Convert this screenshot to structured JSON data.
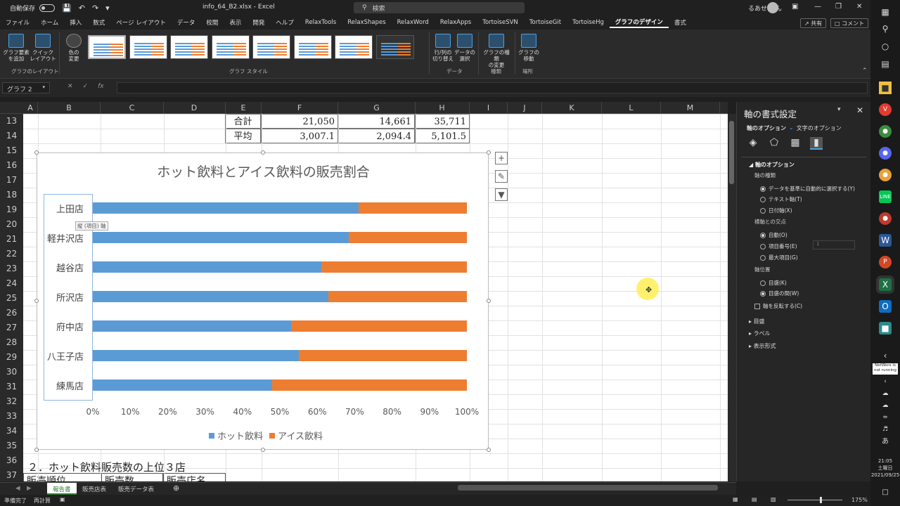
{
  "titlebar": {
    "autosave": "自動保存",
    "filename": "info_64_B2.xlsx  -  Excel",
    "search": "検索",
    "user": "るあせ くん"
  },
  "menu": [
    "ファイル",
    "ホーム",
    "挿入",
    "数式",
    "ページ レイアウト",
    "データ",
    "校閲",
    "表示",
    "開発",
    "ヘルプ",
    "RelaxTools",
    "RelaxShapes",
    "RelaxWord",
    "RelaxApps",
    "TortoiseSVN",
    "TortoiseGit",
    "TortoiseHg",
    "グラフのデザイン",
    "書式"
  ],
  "share": "共有",
  "comment": "コメント",
  "ribbon": {
    "add_element": "グラフ要素\nを追加",
    "quick_layout": "クイック\nレイアウト",
    "change_color": "色の\n変更",
    "switch_rowcol": "行/列の\n切り替え",
    "select_data": "データの\n選択",
    "change_type": "グラフの種類\nの変更",
    "move_chart": "グラフの\n移動",
    "groups": {
      "layout": "グラフのレイアウト",
      "styles": "グラフ スタイル",
      "data": "データ",
      "type": "種類",
      "location": "場所"
    }
  },
  "namebox": "グラフ 2",
  "columns": [
    "A",
    "B",
    "C",
    "D",
    "E",
    "F",
    "G",
    "H",
    "I",
    "J",
    "K",
    "L",
    "M"
  ],
  "rows": [
    "13",
    "14",
    "15",
    "16",
    "17",
    "18",
    "19",
    "20",
    "21",
    "22",
    "23",
    "24",
    "25",
    "26",
    "27",
    "28",
    "29",
    "30",
    "31",
    "32",
    "33",
    "34",
    "35",
    "36",
    "37"
  ],
  "table": {
    "sum_label": "合計",
    "avg_label": "平均",
    "sum": [
      "21,050",
      "14,661",
      "35,711"
    ],
    "avg": [
      "3,007.1",
      "2,094.4",
      "5,101.5"
    ]
  },
  "heading36": "２．ホット飲料販売数の上位３店",
  "row37": [
    "販売順位",
    "販売数",
    "販売店名"
  ],
  "axis_tooltip": "縦 (項目) 軸",
  "chart_data": {
    "type": "bar",
    "title": "ホット飲料とアイス飲料の販売割合",
    "categories": [
      "上田店",
      "軽井沢店",
      "越谷店",
      "所沢店",
      "府中店",
      "八王子店",
      "練馬店"
    ],
    "series": [
      {
        "name": "ホット飲料",
        "values": [
          0.71,
          0.685,
          0.61,
          0.63,
          0.53,
          0.55,
          0.48
        ],
        "color": "#5b9bd5"
      },
      {
        "name": "アイス飲料",
        "values": [
          0.29,
          0.315,
          0.39,
          0.37,
          0.47,
          0.45,
          0.52
        ],
        "color": "#ed7d31"
      }
    ],
    "xticks": [
      "0%",
      "10%",
      "20%",
      "30%",
      "40%",
      "50%",
      "60%",
      "70%",
      "80%",
      "90%",
      "100%"
    ],
    "xlim": [
      0,
      1
    ],
    "stacked": "100%",
    "legend": "bottom"
  },
  "sheets": [
    "報告書",
    "販売店表",
    "販売データ表"
  ],
  "status": {
    "ready": "準備完了",
    "recalc": "再計算",
    "zoom": "175%"
  },
  "pane": {
    "title": "軸の書式設定",
    "tab_axis": "軸のオプション",
    "tab_text": "文字のオプション",
    "section": "軸のオプション",
    "axis_type": "軸の種類",
    "opt_auto": "データを基準に自動的に選択する(Y)",
    "opt_text": "テキスト軸(T)",
    "opt_date": "日付軸(X)",
    "cross": "横軸との交点",
    "cross_auto": "自動(O)",
    "cross_num": "項目番号(E)",
    "cross_num_val": "1",
    "cross_max": "最大項目(G)",
    "position": "軸位置",
    "pos_on": "目盛(K)",
    "pos_between": "目盛の間(W)",
    "reverse": "軸を反転する(C)",
    "tick": "目盛",
    "label": "ラベル",
    "number": "表示形式"
  },
  "taskbar": {
    "time": "21:05",
    "day": "土曜日",
    "date": "2021/09/25",
    "netwox": "NetWorx is not running"
  }
}
